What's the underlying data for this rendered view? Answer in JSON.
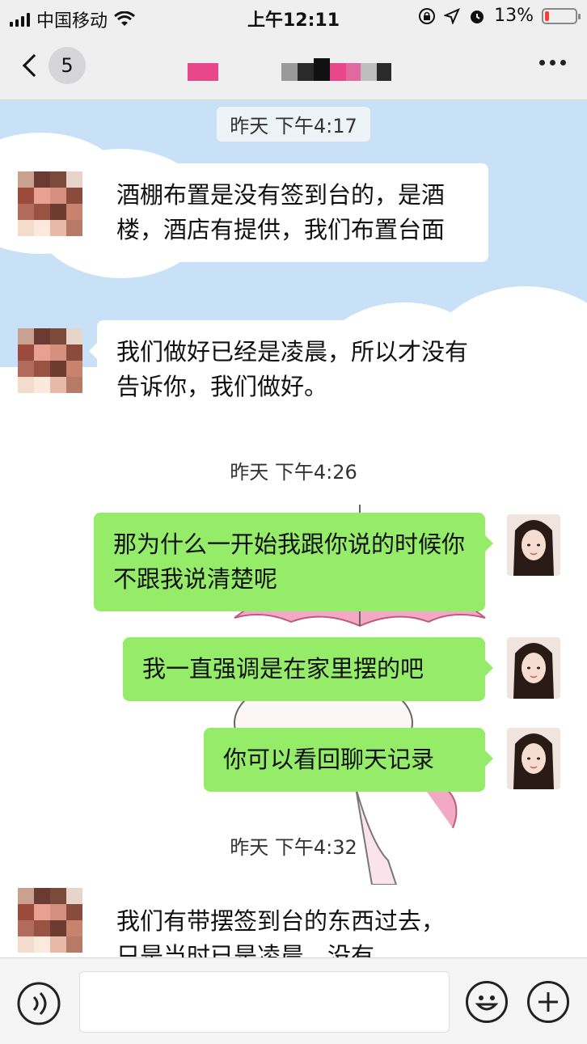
{
  "status_bar": {
    "carrier": "中国移动",
    "time": "上午12:11",
    "battery_percent": "13%",
    "battery_level": 0.13
  },
  "nav": {
    "unread_count": "5"
  },
  "timestamps": [
    "昨天 下午4:17",
    "昨天 下午4:26",
    "昨天 下午4:32"
  ],
  "messages": [
    {
      "from": "other",
      "text": "酒棚布置是没有签到台的，是酒楼，酒店有提供，我们布置台面"
    },
    {
      "from": "other",
      "text": "我们做好已经是凌晨，所以才没有告诉你，我们做好。"
    },
    {
      "from": "me",
      "text": "那为什么一开始我跟你说的时候你不跟我说清楚呢"
    },
    {
      "from": "me",
      "text": "我一直强调是在家里摆的吧"
    },
    {
      "from": "me",
      "text": "你可以看回聊天记录"
    },
    {
      "from": "other",
      "text": "我们有带摆签到台的东西过去，只是当时已是凌晨，没有"
    }
  ],
  "colors": {
    "outgoing_bubble": "#95ec69",
    "incoming_bubble": "#ffffff",
    "sky": "#c9e1f7"
  }
}
